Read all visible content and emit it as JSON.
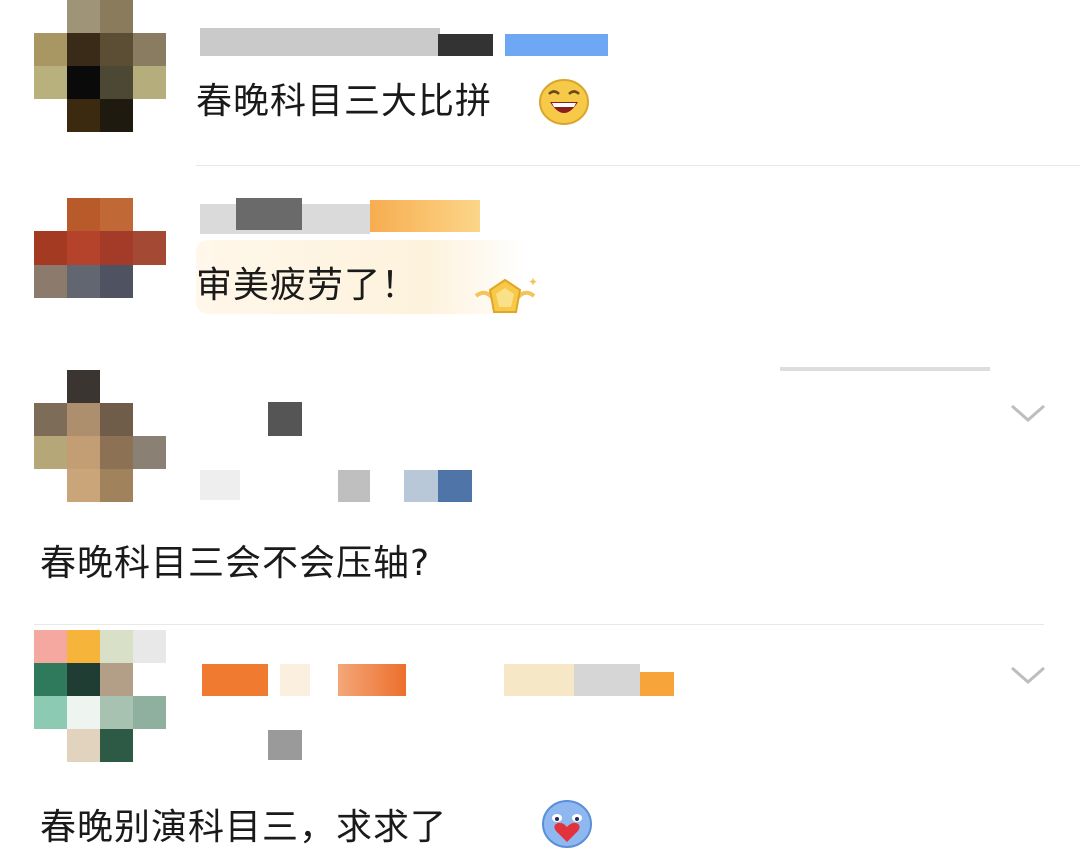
{
  "comments": [
    {
      "id": "c1",
      "text": "春晚科目三大比拼",
      "emoji": "laughing-face-emoji"
    },
    {
      "id": "c2",
      "text": "审美疲劳了！",
      "badge": "gold-badge-icon"
    },
    {
      "id": "c3",
      "text": "春晚科目三会不会压轴?"
    },
    {
      "id": "c4",
      "text": "春晚别演科目三，求求了",
      "emoji": "blue-heart-face-emoji"
    }
  ],
  "colors": {
    "divider": "#e8e8e8",
    "chevron": "#bdbdbd",
    "text": "#1a1a1a",
    "badge_gold": "#f7c948"
  },
  "icons": [
    "chevron-down-icon",
    "laughing-face-emoji",
    "gold-badge-icon",
    "blue-heart-face-emoji"
  ]
}
